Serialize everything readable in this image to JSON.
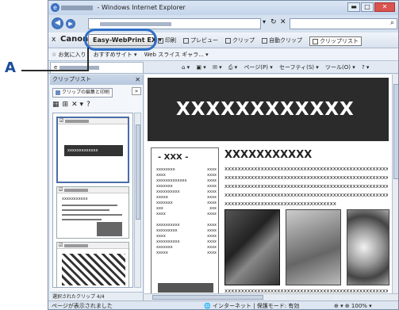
{
  "window": {
    "title": "- Windows Internet Explorer",
    "min": "▬",
    "max": "□",
    "close": "✕"
  },
  "nav": {
    "back": "◀",
    "forward": "▶",
    "addr_arrow": "▾",
    "refresh": "↻",
    "stop": "✕",
    "search_icon": "⌕"
  },
  "ep": {
    "close": "x",
    "canon": "Canon",
    "button": "Easy-WebPrint EX ▾",
    "print": "印刷",
    "preview": "プレビュー",
    "clip": "クリップ",
    "auto_clip": "自動クリップ",
    "clip_list": "クリップリスト"
  },
  "fav": {
    "favorites": "☆ お気に入り",
    "suggest": "おすすめサイト ▾",
    "slice": "Web スライス ギャラ... ▾"
  },
  "cmd": {
    "home": "⌂ ▾",
    "feeds": "▣ ▾",
    "mail": "✉ ▾",
    "print": "⎙ ▾",
    "page": "ページ(P) ▾",
    "safety": "セーフティ(S) ▾",
    "tools": "ツール(O) ▾",
    "help": "? ▾"
  },
  "clippanel": {
    "title": "クリップリスト",
    "close": "✕",
    "edit": "クリップの編集と印刷",
    "more": "»",
    "tools": [
      "▦",
      "⊞",
      "✕ ▾",
      "?"
    ],
    "clip1_text": "xxxxxxxxxxxxx",
    "clip2_text": "xxxxxxxxxxx",
    "footer": "選択されたクリップ 4/4"
  },
  "page": {
    "banner": "XXXXXXXXXXXX",
    "side_title": "- XXX -",
    "side_rows": [
      [
        "xxxxxxxx",
        "xxxx"
      ],
      [
        "xxxx",
        "xxxx"
      ],
      [
        "xxxxxxxxxxxxx",
        "xxxx"
      ],
      [
        "xxxxxxx",
        "xxxx"
      ],
      [
        "xxxxxxxxxx",
        "xxxx"
      ],
      [
        "xxxxx",
        "xxxx"
      ],
      [
        "xxxxxxx",
        "xxxx"
      ],
      [
        "xxx",
        "xxx"
      ],
      [
        "xxxx",
        "xxxx"
      ],
      [
        "xxxxxxxxxx",
        "xxxx"
      ],
      [
        "xxxxxxxxx",
        "xxxx"
      ],
      [
        "xxxx",
        "xxxx"
      ],
      [
        "xxxxxxxxxx",
        "xxxx"
      ],
      [
        "xxxxxxx",
        "xxxx"
      ],
      [
        "xxxxx",
        "xxxx"
      ]
    ],
    "article_title": "XXXXXXXXXXX",
    "article_lines": [
      "xxxxxxxxxxxxxxxxxxxxxxxxxxxxxxxxxxxxxxxxxxxxxxxxxxx",
      "xxxxxxxxxxxxxxxxxxxxxxxxxxxxxxxxxxxxxxxxxxxxxxxxxxx",
      "xxxxxxxxxxxxxxxxxxxxxxxxxxxxxxxxxxxxxxxxxxxxxxxxxxx",
      "xxxxxxxxxxxxxxxxxxxxxxxxxxxxxxxxxxxxxxxxxxxxxxxxxxx",
      "xxxxxxxxxxxxxxxxxxxxxxxxxxxxxxxxxx"
    ],
    "bottom_line": "xxxxxxxxxxxxxxxxxxxxxxxxxxxxxxxxxxxxxxxxxxxxxxxxxxx"
  },
  "status": {
    "left": "ページが表示されました",
    "zone": "🌐 インターネット | 保護モード: 有効",
    "zoom": "⊕ ▾  ⊕ 100% ▾"
  },
  "callout": {
    "label": "A"
  }
}
